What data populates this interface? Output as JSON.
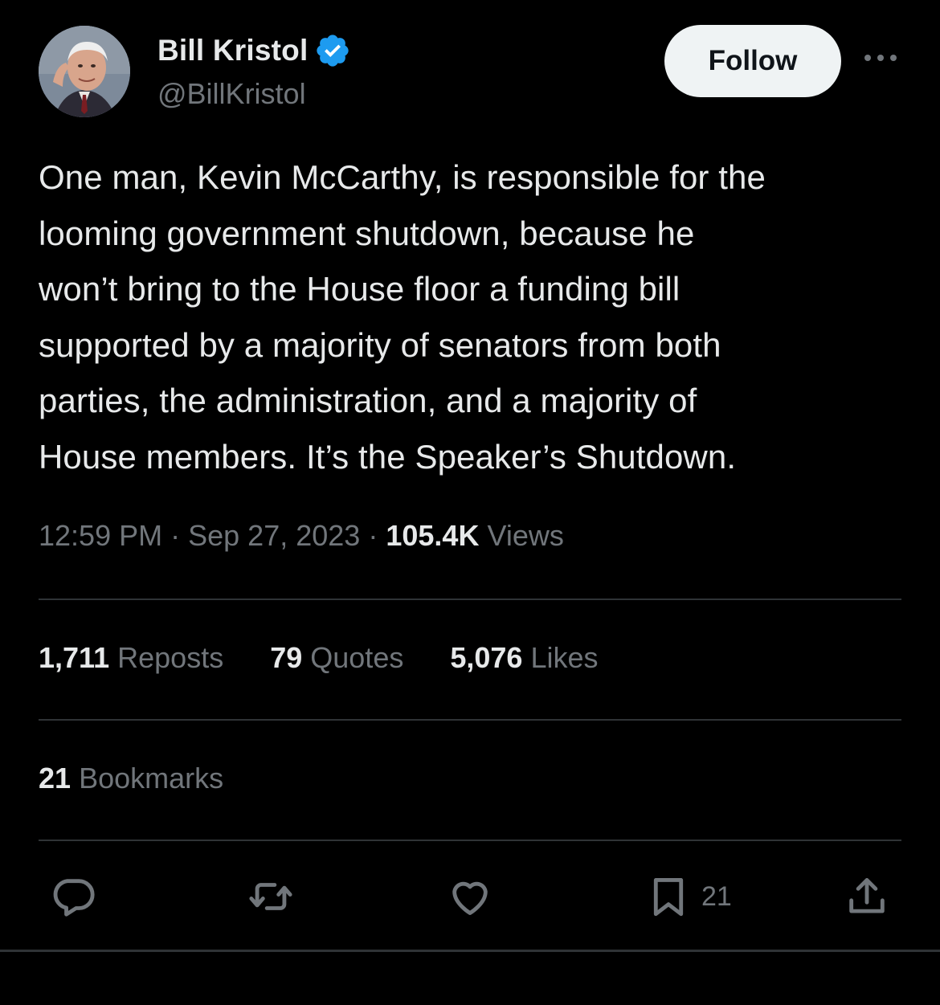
{
  "author": {
    "name": "Bill Kristol",
    "handle": "@BillKristol",
    "verified_color": "#1d9bf0"
  },
  "follow_label": "Follow",
  "more_icon": "more-horizontal-icon",
  "tweet": {
    "text": "One man, Kevin McCarthy, is responsible for the\nlooming government shutdown, because he\nwon’t bring to the House floor a funding bill\nsupported by a majority of senators from both\nparties, the administration, and a majority of\nHouse members. It’s the Speaker’s Shutdown."
  },
  "meta": {
    "time": "12:59 PM",
    "separator": "·",
    "date": "Sep 27, 2023",
    "views_count": "105.4K",
    "views_label": "Views"
  },
  "stats": {
    "reposts_count": "1,711",
    "reposts_label": "Reposts",
    "quotes_count": "79",
    "quotes_label": "Quotes",
    "likes_count": "5,076",
    "likes_label": "Likes",
    "bookmarks_count": "21",
    "bookmarks_label": "Bookmarks"
  },
  "actions": {
    "reply_icon": "reply-icon",
    "repost_icon": "repost-icon",
    "like_icon": "heart-icon",
    "bookmark_icon": "bookmark-icon",
    "bookmark_count": "21",
    "share_icon": "share-icon"
  },
  "colors": {
    "background": "#000000",
    "text_primary": "#e7e9ea",
    "text_secondary": "#71767b",
    "divider": "#2f3336",
    "follow_bg": "#eff3f4"
  }
}
